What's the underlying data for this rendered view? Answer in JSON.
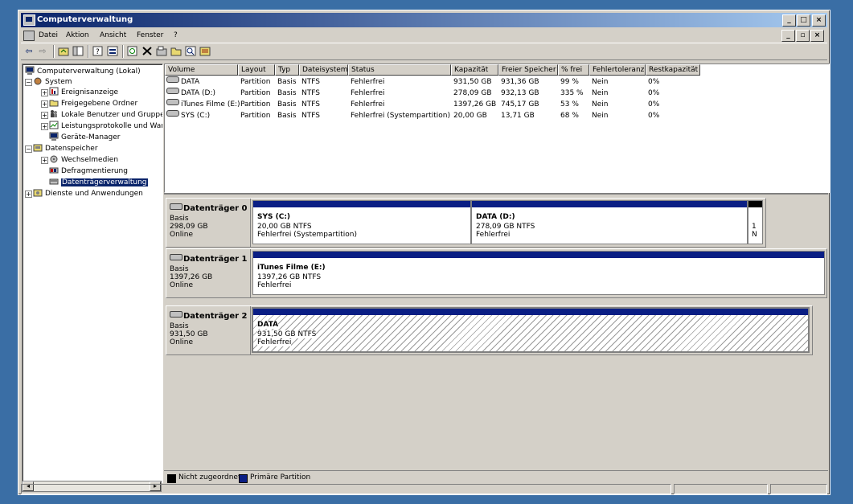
{
  "window": {
    "title": "Computerverwaltung",
    "minimize": "_",
    "maximize": "□",
    "close": "×"
  },
  "menu": {
    "items": [
      "Datei",
      "Aktion",
      "Ansicht",
      "Fenster",
      "?"
    ]
  },
  "mdi": {
    "minimize": "_",
    "restore": "▫",
    "close": "×"
  },
  "toolbar": {
    "back": "⇦",
    "forward": "⇨"
  },
  "tree": {
    "root": "Computerverwaltung (Lokal)",
    "system": "System",
    "ereignis": "Ereignisanzeige",
    "freigegeben": "Freigegebene Ordner",
    "lokale": "Lokale Benutzer und Gruppe",
    "leistung": "Leistungsprotokolle und War",
    "geraete": "Geräte-Manager",
    "datenspeicher": "Datenspeicher",
    "wechsel": "Wechselmedien",
    "defrag": "Defragmentierung",
    "datentraeger": "Datenträgerverwaltung",
    "dienste": "Dienste und Anwendungen"
  },
  "volumes": {
    "columns": [
      "Volume",
      "Layout",
      "Typ",
      "Dateisystem",
      "Status",
      "Kapazität",
      "Freier Speicher",
      "% frei",
      "Fehlertoleranz",
      "Restkapazität"
    ],
    "rows": [
      [
        "DATA",
        "Partition",
        "Basis",
        "NTFS",
        "Fehlerfrei",
        "931,50 GB",
        "931,36 GB",
        "99 %",
        "Nein",
        "0%"
      ],
      [
        "DATA (D:)",
        "Partition",
        "Basis",
        "NTFS",
        "Fehlerfrei",
        "278,09 GB",
        "932,13 GB",
        "335 %",
        "Nein",
        "0%"
      ],
      [
        "iTunes Filme (E:)",
        "Partition",
        "Basis",
        "NTFS",
        "Fehlerfrei",
        "1397,26 GB",
        "745,17 GB",
        "53 %",
        "Nein",
        "0%"
      ],
      [
        "SYS (C:)",
        "Partition",
        "Basis",
        "NTFS",
        "Fehlerfrei (Systempartition)",
        "20,00 GB",
        "13,71 GB",
        "68 %",
        "Nein",
        "0%"
      ]
    ]
  },
  "disks": [
    {
      "name": "Datenträger 0",
      "type": "Basis",
      "size": "298,09 GB",
      "state": "Online",
      "partitions": [
        {
          "name": "SYS  (C:)",
          "size": "20,00 GB NTFS",
          "status": "Fehlerfrei (Systempartition)"
        },
        {
          "name": "DATA  (D:)",
          "size": "278,09 GB NTFS",
          "status": "Fehlerfrei"
        },
        {
          "line1": "1",
          "line2": "N"
        }
      ]
    },
    {
      "name": "Datenträger 1",
      "type": "Basis",
      "size": "1397,26 GB",
      "state": "Online",
      "partitions": [
        {
          "name": "iTunes Filme  (E:)",
          "size": "1397,26 GB NTFS",
          "status": "Fehlerfrei"
        }
      ]
    },
    {
      "name": "Datenträger 2",
      "type": "Basis",
      "size": "931,50 GB",
      "state": "Online",
      "partitions": [
        {
          "name": "DATA",
          "size": "931,50 GB NTFS",
          "status": "Fehlerfrei"
        }
      ]
    }
  ],
  "legend": {
    "unallocated": "Nicht zugeordnet",
    "primary": "Primäre Partition",
    "unallocated_color": "#000000",
    "primary_color": "#0a1e84"
  },
  "scroll": {
    "left": "◂",
    "right": "▸"
  }
}
